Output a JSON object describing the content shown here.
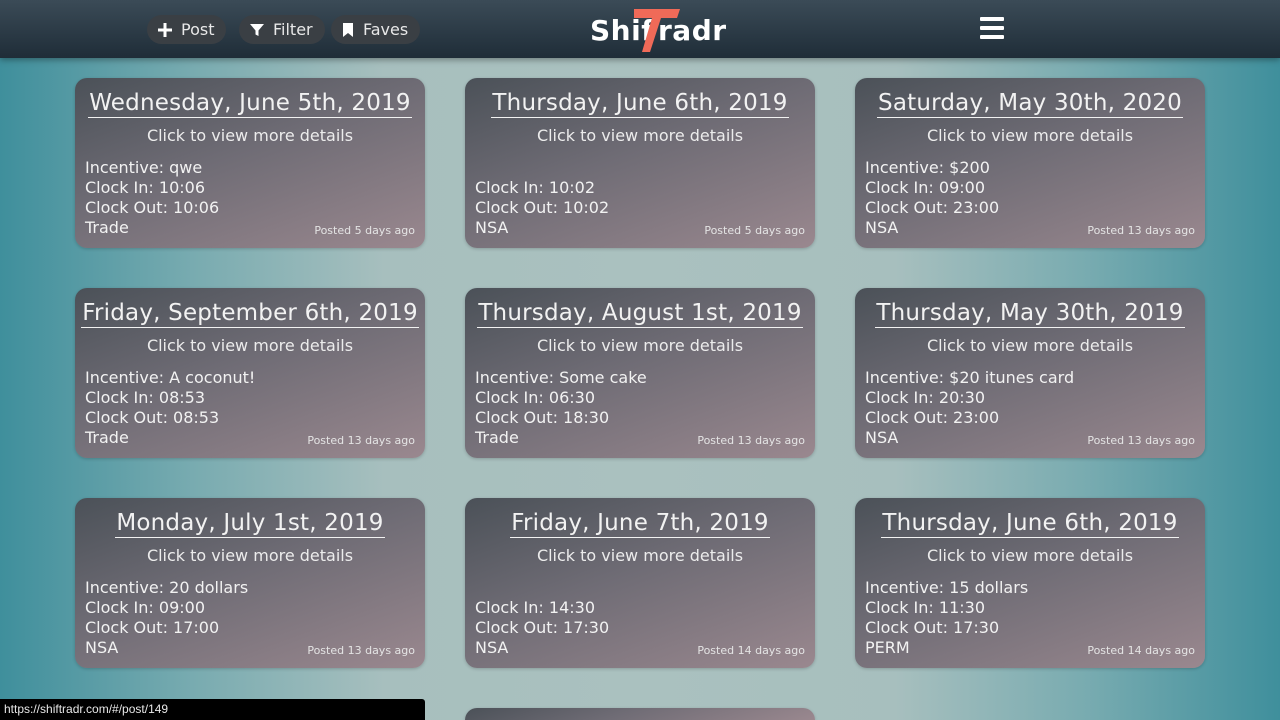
{
  "nav": {
    "post_label": "Post",
    "filter_label": "Filter",
    "faves_label": "Faves",
    "logo_part1": "Shif",
    "logo_t": "T",
    "logo_part2": "radr"
  },
  "colors": {
    "logo_accent": "#f06a58",
    "navbar": "#1f2d38",
    "card_bg": "#6f6c75"
  },
  "cards": [
    {
      "date": "Wednesday, June 5th, 2019",
      "hint": "Click to view more details",
      "incentive": "Incentive: qwe",
      "clock_in": "Clock In: 10:06",
      "clock_out": "Clock Out: 10:06",
      "type": "Trade",
      "posted": "Posted 5 days ago"
    },
    {
      "date": "Thursday, June 6th, 2019",
      "hint": "Click to view more details",
      "incentive": "",
      "clock_in": "Clock In: 10:02",
      "clock_out": "Clock Out: 10:02",
      "type": "NSA",
      "posted": "Posted 5 days ago"
    },
    {
      "date": "Saturday, May 30th, 2020",
      "hint": "Click to view more details",
      "incentive": "Incentive: $200",
      "clock_in": "Clock In: 09:00",
      "clock_out": "Clock Out: 23:00",
      "type": "NSA",
      "posted": "Posted 13 days ago"
    },
    {
      "date": "Friday, September 6th, 2019",
      "hint": "Click to view more details",
      "incentive": "Incentive: A coconut!",
      "clock_in": "Clock In: 08:53",
      "clock_out": "Clock Out: 08:53",
      "type": "Trade",
      "posted": "Posted 13 days ago"
    },
    {
      "date": "Thursday, August 1st, 2019",
      "hint": "Click to view more details",
      "incentive": "Incentive: Some cake",
      "clock_in": "Clock In: 06:30",
      "clock_out": "Clock Out: 18:30",
      "type": "Trade",
      "posted": "Posted 13 days ago"
    },
    {
      "date": "Thursday, May 30th, 2019",
      "hint": "Click to view more details",
      "incentive": "Incentive: $20 itunes card",
      "clock_in": "Clock In: 20:30",
      "clock_out": "Clock Out: 23:00",
      "type": "NSA",
      "posted": "Posted 13 days ago"
    },
    {
      "date": "Monday, July 1st, 2019",
      "hint": "Click to view more details",
      "incentive": "Incentive: 20 dollars",
      "clock_in": "Clock In: 09:00",
      "clock_out": "Clock Out: 17:00",
      "type": "NSA",
      "posted": "Posted 13 days ago"
    },
    {
      "date": "Friday, June 7th, 2019",
      "hint": "Click to view more details",
      "incentive": "",
      "clock_in": "Clock In: 14:30",
      "clock_out": "Clock Out: 17:30",
      "type": "NSA",
      "posted": "Posted 14 days ago"
    },
    {
      "date": "Thursday, June 6th, 2019",
      "hint": "Click to view more details",
      "incentive": "Incentive: 15 dollars",
      "clock_in": "Clock In: 11:30",
      "clock_out": "Clock Out: 17:30",
      "type": "PERM",
      "posted": "Posted 14 days ago"
    }
  ],
  "status_bar": {
    "url": "https://shiftradr.com/#/post/149"
  }
}
